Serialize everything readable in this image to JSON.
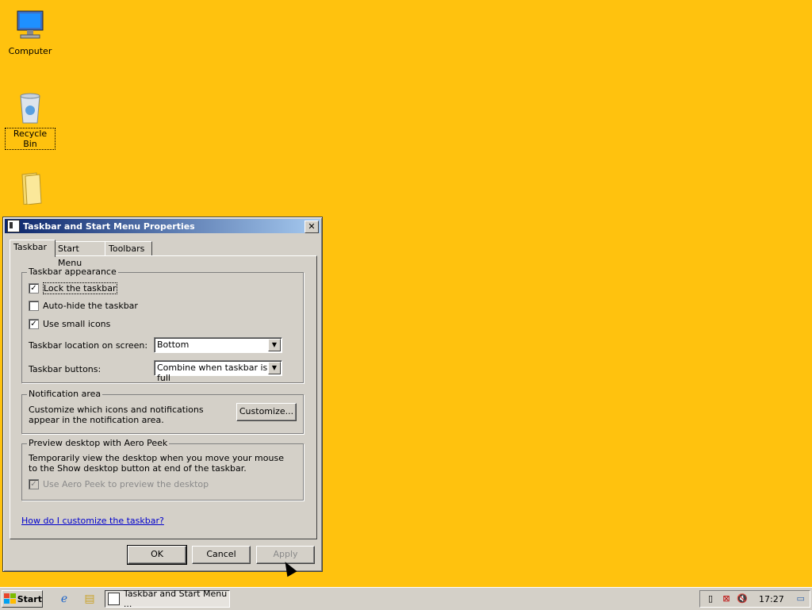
{
  "desktop": {
    "icons": [
      {
        "label": "Computer"
      },
      {
        "label": "Recycle Bin"
      }
    ]
  },
  "dialog": {
    "title": "Taskbar and Start Menu Properties",
    "close_glyph": "✕",
    "tabs": [
      "Taskbar",
      "Start Menu",
      "Toolbars"
    ],
    "appearance": {
      "legend": "Taskbar appearance",
      "lock_label": "Lock the taskbar",
      "lock_checked": true,
      "autohide_label": "Auto-hide the taskbar",
      "autohide_checked": false,
      "small_icons_label": "Use small icons",
      "small_icons_checked": true,
      "location_label": "Taskbar location on screen:",
      "location_value": "Bottom",
      "buttons_label": "Taskbar buttons:",
      "buttons_value": "Combine when taskbar is full"
    },
    "notification": {
      "legend": "Notification area",
      "description": "Customize which icons and notifications appear in the notification area.",
      "customize_label": "Customize..."
    },
    "aero_peek": {
      "legend": "Preview desktop with Aero Peek",
      "description": "Temporarily view the desktop when you move your mouse to the Show desktop button at end of the taskbar.",
      "checkbox_label": "Use Aero Peek to preview the desktop",
      "checked": true,
      "enabled": false
    },
    "help_link": "How do I customize the taskbar?",
    "ok_label": "OK",
    "cancel_label": "Cancel",
    "apply_label": "Apply"
  },
  "taskbar": {
    "start_label": "Start",
    "task_label": "Taskbar and Start Menu ...",
    "clock": "17:27",
    "accent": "#FFC20E"
  }
}
